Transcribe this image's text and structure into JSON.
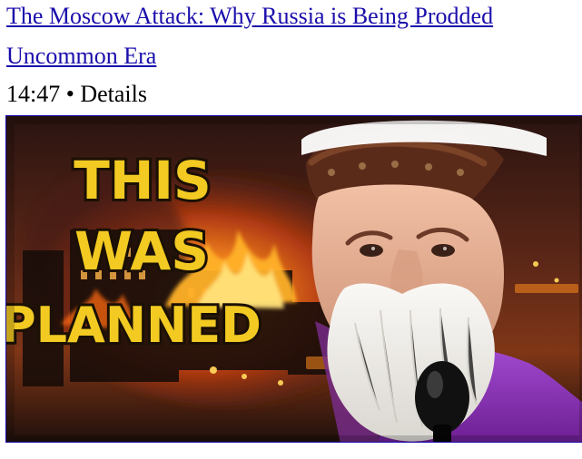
{
  "video": {
    "title": "The Moscow Attack: Why Russia is Being Prodded",
    "channel": "Uncommon Era",
    "duration": "14:47",
    "separator": "•",
    "details_label": "Details"
  },
  "thumbnail": {
    "text_lines": [
      "THIS",
      "WAS",
      "PLANNED"
    ],
    "colors": {
      "link": "#1a0dab",
      "text_fill": "#f2ca22",
      "text_stroke": "#1b1004",
      "sky": "#2a1612",
      "fire": "#ff8a1e",
      "beard": "#f0ede7",
      "robe": "#8c2ab5",
      "mic": "#111111"
    }
  }
}
